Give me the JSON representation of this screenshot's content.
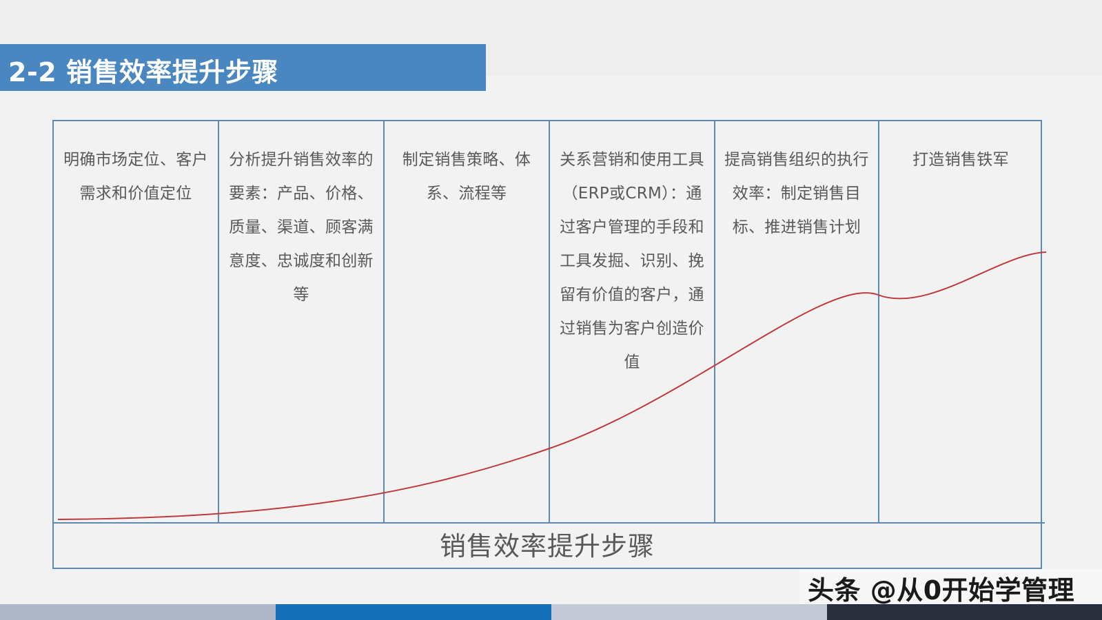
{
  "header": {
    "title": "2-2 销售效率提升步骤"
  },
  "diagram": {
    "steps": [
      {
        "text": "明确市场定位、客户需求和价值定位"
      },
      {
        "text": "分析提升销售效率的要素：产品、价格、质量、渠道、顾客满意度、忠诚度和创新等"
      },
      {
        "text": "制定销售策略、体系、流程等"
      },
      {
        "text": "关系营销和使用工具（ERP或CRM）：通过客户管理的手段和工具发掘、识别、挽留有价值的客户，通过销售为客户创造价值"
      },
      {
        "text": "提高销售组织的执行效率：制定销售目标、推进销售计划"
      },
      {
        "text": "打造销售铁军"
      }
    ],
    "caption": "销售效率提升步骤",
    "curve_color": "#c0393b",
    "border_color": "#5b89b1"
  },
  "footer": {
    "watermark": "头条 @从0开始学管理",
    "strip_colors": [
      "#b0b8c8",
      "#1470b8",
      "#c4cad6",
      "#2a2f3e"
    ]
  }
}
